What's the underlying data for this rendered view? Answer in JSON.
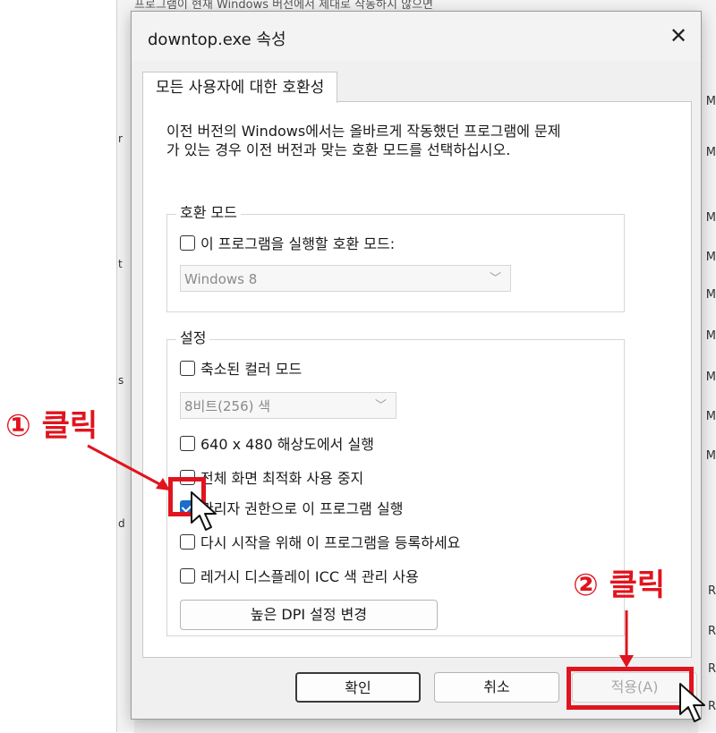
{
  "background": {
    "title_fragment": "프로그램이 현재 Windows 버전에서 제대로 작동하지 않으면",
    "right_letters": [
      "M",
      "M",
      "M",
      "M",
      "M",
      "M",
      "M",
      "M",
      "M",
      "R",
      "R",
      "R",
      "R"
    ],
    "left_letters": [
      "r",
      "t",
      "s",
      "d"
    ]
  },
  "dialog": {
    "title": "downtop.exe 속성",
    "tab": "모든 사용자에 대한 호환성",
    "intro_line1": "이전 버전의 Windows에서는 올바르게 작동했던 프로그램에 문제",
    "intro_line2": "가 있는 경우 이전 버전과 맞는 호환 모드를 선택하십시오.",
    "compat_group": {
      "label": "호환 모드",
      "checkbox_label": "이 프로그램을 실행할 호환 모드:",
      "checked": false,
      "select_value": "Windows 8"
    },
    "settings_group": {
      "label": "설정",
      "items": [
        {
          "label": "축소된 컬러 모드",
          "checked": false
        },
        {
          "label": "640 x 480 해상도에서 실행",
          "checked": false
        },
        {
          "label": "전체 화면 최적화 사용 중지",
          "checked": false
        },
        {
          "label": "관리자 권한으로 이 프로그램 실행",
          "checked": true
        },
        {
          "label": "다시 시작을 위해 이 프로그램을 등록하세요",
          "checked": false
        },
        {
          "label": "레거시 디스플레이 ICC 색 관리 사용",
          "checked": false
        }
      ],
      "color_select_value": "8비트(256) 색",
      "dpi_button": "높은 DPI 설정 변경"
    },
    "buttons": {
      "ok": "확인",
      "cancel": "취소",
      "apply": "적용(A)"
    }
  },
  "annotations": {
    "step1": "① 클릭",
    "step2": "② 클릭",
    "color": "#e0141e"
  }
}
